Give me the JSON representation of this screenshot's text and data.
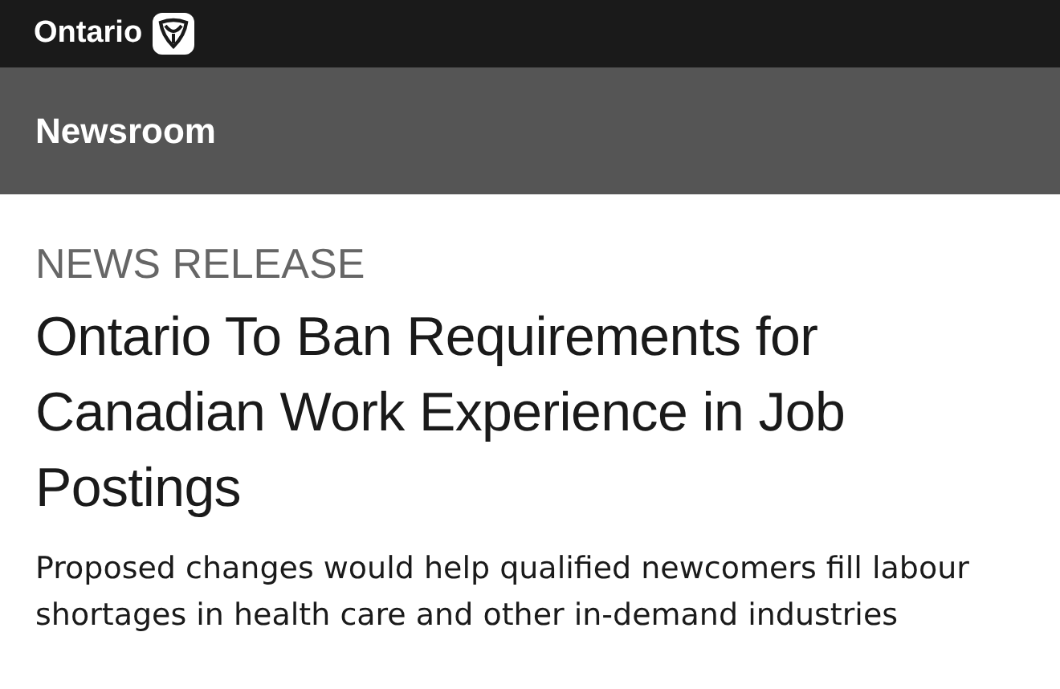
{
  "top_bar": {
    "brand": "Ontario"
  },
  "section_bar": {
    "title": "Newsroom"
  },
  "article": {
    "kicker": "NEWS RELEASE",
    "headline": "Ontario To Ban Requirements for Canadian Work Experience in Job Postings",
    "summary": "Proposed changes would help qualified newcomers fill labour shortages in health care and other in-demand industries"
  }
}
